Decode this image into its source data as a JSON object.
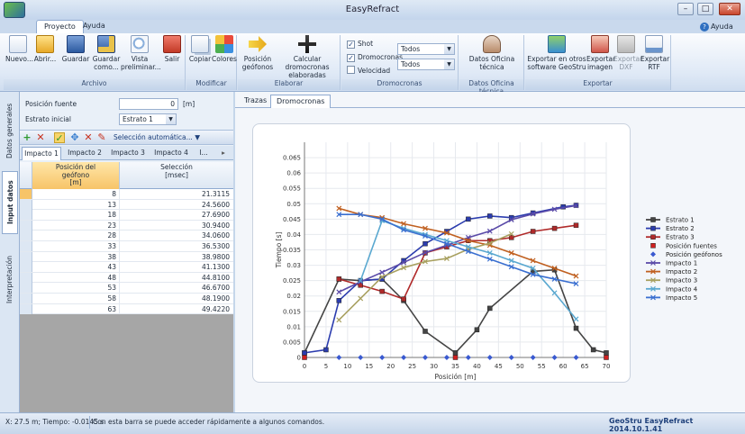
{
  "window": {
    "title": "EasyRefract"
  },
  "tabs": {
    "proyecto": "Proyecto",
    "ayuda": "Ayuda",
    "help": "Ayuda"
  },
  "ribbon": {
    "archivo": {
      "label": "Archivo",
      "nuevo": "Nuevo...",
      "abrir": "Abrir...",
      "guardar": "Guardar",
      "guardar_como": "Guardar como...",
      "vista": "Vista preliminar...",
      "salir": "Salir"
    },
    "modificar": {
      "label": "Modificar",
      "copiar": "Copiar",
      "colores": "Colores"
    },
    "elaborar": {
      "label": "Elaborar",
      "posicion": "Posición geófonos",
      "calcular": "Calcular dromocronas elaboradas"
    },
    "dromocronas": {
      "label": "Dromocronas",
      "shot": "Shot",
      "dromocronas": "Dromocronas",
      "velocidad": "Velocidad",
      "combo1": "Todos",
      "combo2": "Todos"
    },
    "oficina": {
      "label": "Datos Oficina técnica",
      "btn": "Datos Oficina técnica"
    },
    "exportar": {
      "label": "Exportar",
      "otros": "Exportar en otros software GeoStru",
      "imagen": "Exportar imagen",
      "dxf": "Exportar DXF",
      "rtf": "Exportar RTF"
    }
  },
  "sidebar": {
    "datos": "Datos generales",
    "input": "Input datos",
    "interp": "Interpretación"
  },
  "form": {
    "pos_label": "Posición fuente",
    "pos_value": "0",
    "pos_unit": "[m]",
    "estrato_label": "Estrato inicial",
    "estrato_value": "Estrato 1"
  },
  "toolbar": {
    "auto": "Selección automática..."
  },
  "impactos": [
    "Impacto 1",
    "Impacto 2",
    "Impacto 3",
    "Impacto 4",
    "I..."
  ],
  "grid": {
    "col1": "Posición del\ngeófono\n[m]",
    "col2": "Selección\n[msec]",
    "rows": [
      [
        "8",
        "21.3115"
      ],
      [
        "13",
        "24.5600"
      ],
      [
        "18",
        "27.6900"
      ],
      [
        "23",
        "30.9400"
      ],
      [
        "28",
        "34.0600"
      ],
      [
        "33",
        "36.5300"
      ],
      [
        "38",
        "38.9800"
      ],
      [
        "43",
        "41.1300"
      ],
      [
        "48",
        "44.8100"
      ],
      [
        "53",
        "46.6700"
      ],
      [
        "58",
        "48.1900"
      ],
      [
        "63",
        "49.4220"
      ]
    ]
  },
  "main_tabs": {
    "trazas": "Trazas",
    "drom": "Dromocronas"
  },
  "chart_data": {
    "type": "line",
    "xlabel": "Posición [m]",
    "ylabel": "Tiempo [s]",
    "xlim": [
      0,
      70
    ],
    "ylim": [
      0,
      0.07
    ],
    "xticks": [
      "0",
      "5",
      "10",
      "15",
      "20",
      "25",
      "30",
      "35",
      "40",
      "45",
      "50",
      "55",
      "60",
      "65",
      "70"
    ],
    "yticks": [
      "0",
      "0.005",
      "0.01",
      "0.015",
      "0.02",
      "0.025",
      "0.03",
      "0.035",
      "0.04",
      "0.045",
      "0.05",
      "0.055",
      "0.06",
      "0.065"
    ],
    "grid": true,
    "legend_position": "right",
    "series": [
      {
        "name": "Estrato 1",
        "color": "#444444",
        "marker": "square",
        "points": [
          [
            0,
            0.0015
          ],
          [
            8,
            0.0255
          ],
          [
            13,
            0.025
          ],
          [
            18,
            0.0255
          ],
          [
            23,
            0.0185
          ],
          [
            28,
            0.0085
          ],
          [
            35,
            0.0015
          ],
          [
            40,
            0.009
          ],
          [
            43,
            0.016
          ],
          [
            53,
            0.028
          ],
          [
            58,
            0.0285
          ],
          [
            63,
            0.0095
          ],
          [
            67,
            0.0025
          ],
          [
            70,
            0.0015
          ]
        ]
      },
      {
        "name": "Estrato 2",
        "color": "#2b3cae",
        "marker": "square",
        "points": [
          [
            0,
            0.0015
          ],
          [
            5,
            0.0025
          ],
          [
            8,
            0.0185
          ],
          [
            13,
            0.025
          ],
          [
            18,
            0.0255
          ],
          [
            23,
            0.0315
          ],
          [
            28,
            0.037
          ],
          [
            33,
            0.041
          ],
          [
            38,
            0.045
          ],
          [
            43,
            0.046
          ],
          [
            48,
            0.0455
          ],
          [
            53,
            0.047
          ],
          [
            60,
            0.049
          ],
          [
            63,
            0.0495
          ]
        ]
      },
      {
        "name": "Estrato 3",
        "color": "#b02a2a",
        "marker": "square",
        "points": [
          [
            8,
            0.0255
          ],
          [
            13,
            0.0235
          ],
          [
            18,
            0.0215
          ],
          [
            23,
            0.019
          ],
          [
            28,
            0.034
          ],
          [
            33,
            0.036
          ],
          [
            38,
            0.038
          ],
          [
            43,
            0.038
          ],
          [
            48,
            0.039
          ],
          [
            53,
            0.041
          ],
          [
            58,
            0.042
          ],
          [
            63,
            0.043
          ]
        ]
      },
      {
        "name": "Posición fuentes",
        "color": "#d02020",
        "marker": "square",
        "points": [
          [
            0,
            0
          ],
          [
            35,
            0
          ],
          [
            70,
            0
          ]
        ]
      },
      {
        "name": "Posición geófonos",
        "color": "#3a5ad0",
        "marker": "diamond",
        "points": [
          [
            8,
            0
          ],
          [
            13,
            0
          ],
          [
            18,
            0
          ],
          [
            23,
            0
          ],
          [
            28,
            0
          ],
          [
            33,
            0
          ],
          [
            38,
            0
          ],
          [
            43,
            0
          ],
          [
            48,
            0
          ],
          [
            53,
            0
          ],
          [
            58,
            0
          ],
          [
            63,
            0
          ]
        ]
      },
      {
        "name": "Impacto 1",
        "color": "#5a4aa8",
        "marker": "cross",
        "points": [
          [
            8,
            0.0213
          ],
          [
            13,
            0.0246
          ],
          [
            18,
            0.0277
          ],
          [
            23,
            0.0309
          ],
          [
            28,
            0.0341
          ],
          [
            33,
            0.0365
          ],
          [
            38,
            0.039
          ],
          [
            43,
            0.0411
          ],
          [
            48,
            0.0448
          ],
          [
            53,
            0.0467
          ],
          [
            58,
            0.0482
          ],
          [
            63,
            0.0494
          ]
        ]
      },
      {
        "name": "Impacto 2",
        "color": "#c06020",
        "marker": "cross",
        "points": [
          [
            8,
            0.0485
          ],
          [
            13,
            0.0465
          ],
          [
            18,
            0.0455
          ],
          [
            23,
            0.0435
          ],
          [
            28,
            0.042
          ],
          [
            33,
            0.0405
          ],
          [
            38,
            0.038
          ],
          [
            43,
            0.0365
          ],
          [
            48,
            0.034
          ],
          [
            53,
            0.0315
          ],
          [
            58,
            0.029
          ],
          [
            63,
            0.0265
          ]
        ]
      },
      {
        "name": "Impacto 3",
        "color": "#a8a060",
        "marker": "cross",
        "points": [
          [
            8,
            0.0122
          ],
          [
            13,
            0.0192
          ],
          [
            18,
            0.0262
          ],
          [
            23,
            0.0292
          ],
          [
            28,
            0.0312
          ],
          [
            33,
            0.0322
          ],
          [
            38,
            0.0352
          ],
          [
            43,
            0.0372
          ],
          [
            48,
            0.0402
          ]
        ]
      },
      {
        "name": "Impacto 4",
        "color": "#5aa8d0",
        "marker": "cross",
        "points": [
          [
            13,
            0.025
          ],
          [
            18,
            0.0445
          ],
          [
            23,
            0.042
          ],
          [
            28,
            0.04
          ],
          [
            33,
            0.038
          ],
          [
            38,
            0.036
          ],
          [
            43,
            0.034
          ],
          [
            48,
            0.0315
          ],
          [
            53,
            0.029
          ],
          [
            58,
            0.021
          ],
          [
            63,
            0.0125
          ]
        ]
      },
      {
        "name": "Impacto 5",
        "color": "#3a6fd0",
        "marker": "cross",
        "points": [
          [
            8,
            0.0465
          ],
          [
            13,
            0.0465
          ],
          [
            18,
            0.045
          ],
          [
            23,
            0.0415
          ],
          [
            28,
            0.0395
          ],
          [
            33,
            0.037
          ],
          [
            38,
            0.0345
          ],
          [
            43,
            0.032
          ],
          [
            48,
            0.0295
          ],
          [
            53,
            0.027
          ],
          [
            58,
            0.0255
          ],
          [
            63,
            0.024
          ]
        ]
      }
    ]
  },
  "status": {
    "coords": "X: 27.5 m; Tiempo: -0.0145 s",
    "message": "Con esta barra se puede acceder rápidamente a algunos comandos.",
    "brand": "GeoStru EasyRefract 2014.10.1.41"
  }
}
